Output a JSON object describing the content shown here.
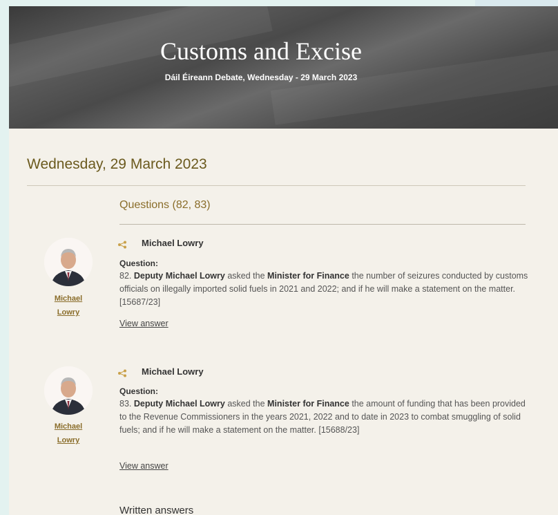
{
  "header": {
    "title": "Customs and Excise",
    "subtitle": "Dáil Éireann Debate, Wednesday - 29 March 2023"
  },
  "date_heading": "Wednesday, 29 March 2023",
  "section_heading": "Questions (82, 83)",
  "questions": [
    {
      "asker": "Michael Lowry",
      "member_first": "Michael",
      "member_last": "Lowry",
      "label": "Question:",
      "number": "82.",
      "deputy": "Deputy Michael Lowry",
      "asked": "asked the",
      "minister": "Minister for Finance",
      "text": "the number of seizures conducted by customs officials on illegally imported solid fuels in 2021 and 2022; and if he will make a statement on the matter. [15687/23]",
      "view_answer": "View answer"
    },
    {
      "asker": "Michael Lowry",
      "member_first": "Michael",
      "member_last": "Lowry",
      "label": "Question:",
      "number": "83.",
      "deputy": "Deputy Michael Lowry",
      "asked": "asked the",
      "minister": "Minister for Finance",
      "text": "the amount of funding that has been provided to the Revenue Commissioners in the years 2021, 2022 and to date in 2023 to combat smuggling of solid fuels; and if he will make a statement on the matter. [15688/23]",
      "view_answer": "View answer"
    }
  ],
  "written_answers": "Written answers",
  "colors": {
    "accent_gold": "#8a6d2a",
    "heading_brown": "#6b5a1e",
    "page_bg": "#f4f1ea",
    "outer_bg": "#e3f2f0"
  }
}
